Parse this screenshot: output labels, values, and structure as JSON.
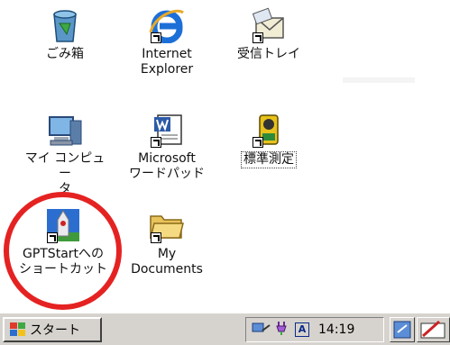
{
  "desktop": {
    "icons": [
      {
        "label": "ごみ箱"
      },
      {
        "label": "Internet\nExplorer"
      },
      {
        "label": "受信トレイ"
      },
      {
        "label": "マイ コンピュー\nタ"
      },
      {
        "label": "Microsoft\nワードパッド"
      },
      {
        "label": "標準測定"
      },
      {
        "label": "GPTStartへの\nショートカット"
      },
      {
        "label": "My\nDocuments"
      }
    ]
  },
  "taskbar": {
    "start_label": "スタート",
    "ime_indicator": "A",
    "clock": "14:19"
  },
  "colors": {
    "highlight_circle": "#e52222",
    "taskbar": "#d6d3ce"
  }
}
